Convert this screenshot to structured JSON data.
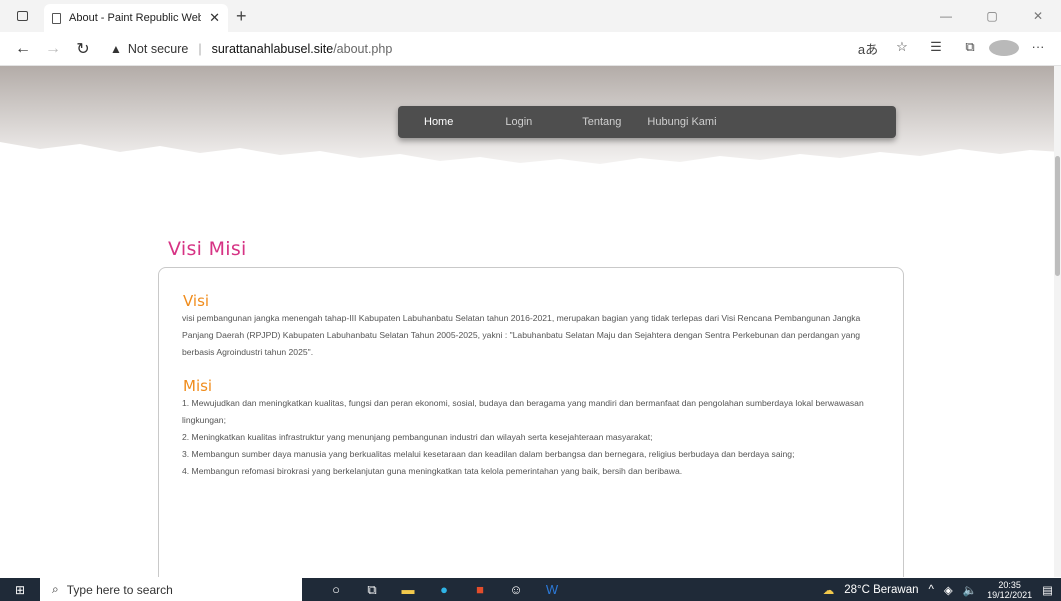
{
  "browser": {
    "tab_title": "About - Paint Republic Web Tem",
    "address": {
      "security_label": "Not secure",
      "host": "surattanahlabusel.site",
      "path": "/about.php"
    }
  },
  "nav": {
    "items": [
      "Home",
      "Login",
      "Tentang",
      "Hubungi Kami"
    ]
  },
  "page": {
    "title": "Visi Misi",
    "visi_heading": "Visi",
    "visi_text": "visi pembangunan jangka menengah tahap-III Kabupaten Labuhanbatu Selatan tahun 2016-2021, merupakan bagian yang tidak terlepas dari Visi Rencana Pembangunan Jangka Panjang Daerah (RPJPD) Kabupaten Labuhanbatu Selatan Tahun 2005-2025, yakni : \"Labuhanbatu Selatan Maju dan Sejahtera dengan Sentra Perkebunan dan perdangan yang berbasis Agroindustri tahun 2025\".",
    "misi_heading": "Misi",
    "misi_items": [
      "1. Mewujudkan dan meningkatkan kualitas, fungsi dan peran ekonomi, sosial, budaya dan beragama yang mandiri dan bermanfaat dan pengolahan sumberdaya lokal berwawasan lingkungan;",
      "2. Meningkatkan kualitas infrastruktur yang menunjang pembangunan industri dan wilayah serta kesejahteraan masyarakat;",
      "3. Membangun sumber daya manusia yang berkualitas melalui kesetaraan dan keadilan dalam berbangsa dan bernegara, religius berbudaya dan berdaya saing;",
      "4. Membangun refomasi birokrasi yang berkelanjutan guna meningkatkan tata kelola pemerintahan yang baik, bersih dan beribawa."
    ]
  },
  "taskbar": {
    "search_placeholder": "Type here to search",
    "weather": "28°C  Berawan",
    "time": "20:35",
    "date": "19/12/2021"
  },
  "colors": {
    "title_pink": "#d63384",
    "heading_orange": "#f08c1c",
    "nav_bg": "#4e4e4e"
  }
}
